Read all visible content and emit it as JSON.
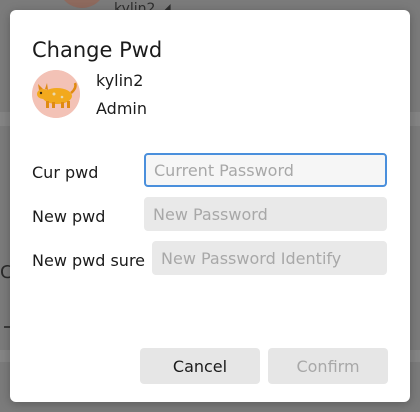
{
  "background": {
    "username_fragment": "kylin2 ◢",
    "edge_char": "C"
  },
  "dialog": {
    "title": "Change Pwd",
    "user": {
      "name": "kylin2",
      "role": "Admin",
      "avatar_icon": "cartoon-yellow-animal-avatar"
    },
    "fields": {
      "current": {
        "label": "Cur pwd",
        "placeholder": "Current Password",
        "value": ""
      },
      "new": {
        "label": "New pwd",
        "placeholder": "New Password",
        "value": ""
      },
      "confirm": {
        "label": "New pwd sure",
        "placeholder": "New Password Identify",
        "value": ""
      }
    },
    "buttons": {
      "cancel": "Cancel",
      "confirm": "Confirm"
    }
  },
  "colors": {
    "focus_border": "#4a8fdc",
    "input_bg": "#e9e9e9",
    "button_bg": "#e6e6e6",
    "disabled_text": "#a8a8a8",
    "overlay": "#7b7b7b"
  }
}
